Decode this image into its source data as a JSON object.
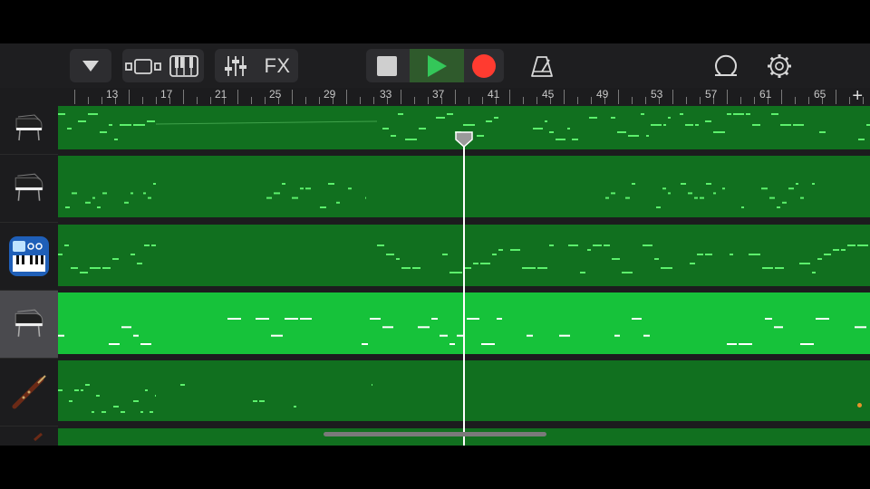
{
  "app": "GarageBand",
  "toolbar": {
    "browser_dropdown": "chevron-down-icon",
    "view_tracks": "tracks-view-icon",
    "view_keyboard": "keyboard-icon",
    "mixer": "mixer-sliders-icon",
    "fx_label": "FX",
    "stop": "stop-icon",
    "play": "play-icon",
    "record": "record-icon",
    "metronome": "metronome-icon",
    "loop": "loop-icon",
    "settings": "gear-icon"
  },
  "ruler": {
    "bars": [
      "13",
      "17",
      "21",
      "25",
      "29",
      "33",
      "37",
      "41",
      "45",
      "49",
      "53",
      "57",
      "61",
      "65"
    ],
    "add_track_label": "+"
  },
  "tracks": [
    {
      "instrument": "grand-piano",
      "selected": false
    },
    {
      "instrument": "grand-piano",
      "selected": false
    },
    {
      "instrument": "synthesizer-keyboard",
      "selected": false
    },
    {
      "instrument": "grand-piano",
      "selected": true
    },
    {
      "instrument": "bassoon",
      "selected": false
    },
    {
      "instrument": "instrument",
      "selected": false
    }
  ],
  "colors": {
    "region": "#11701f",
    "region_selected": "#16c23a",
    "notes": "#5cf06c",
    "notes_selected": "#ffffff",
    "record": "#ff3b30",
    "play": "#34c759"
  }
}
